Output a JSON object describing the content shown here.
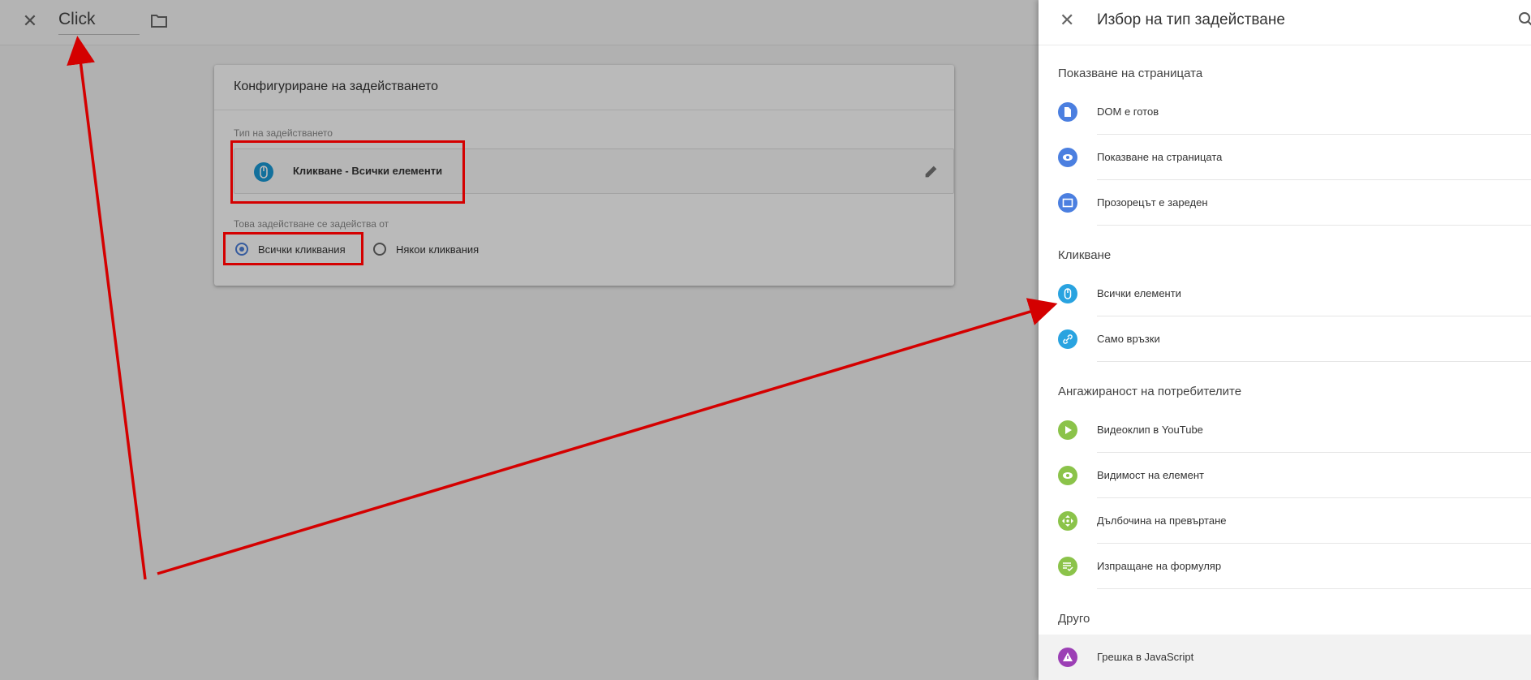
{
  "editor": {
    "close_icon": "close-icon",
    "tag_name": "Click",
    "folder_icon": "folder-icon",
    "card_title": "Конфигуриране на задействането",
    "trigger_type_label": "Тип на задействането",
    "trigger_type_value": "Кликване - Всички елементи",
    "fires_on_label": "Това задействане се задейства от",
    "radio_all": "Всички кликвания",
    "radio_some": "Някои кликвания",
    "selected_radio": "Всички кликвания"
  },
  "panel": {
    "title": "Избор на тип задействане",
    "sections": [
      {
        "title": "Показване на страницата",
        "items": [
          {
            "label": "DOM е готов",
            "icon": "document-icon",
            "color": "#4b7fe0"
          },
          {
            "label": "Показване на страницата",
            "icon": "eye-icon",
            "color": "#4b7fe0"
          },
          {
            "label": "Прозорецът е зареден",
            "icon": "window-icon",
            "color": "#4b7fe0"
          }
        ]
      },
      {
        "title": "Кликване",
        "items": [
          {
            "label": "Всички елементи",
            "icon": "mouse-icon",
            "color": "#29a3e0"
          },
          {
            "label": "Само връзки",
            "icon": "link-icon",
            "color": "#29a3e0"
          }
        ]
      },
      {
        "title": "Ангажираност на потребителите",
        "items": [
          {
            "label": "Видеоклип в YouTube",
            "icon": "play-icon",
            "color": "#8bc34a"
          },
          {
            "label": "Видимост на елемент",
            "icon": "eye-icon",
            "color": "#8bc34a"
          },
          {
            "label": "Дълбочина на превъртане",
            "icon": "scroll-icon",
            "color": "#8bc34a"
          },
          {
            "label": "Изпращане на формуляр",
            "icon": "form-icon",
            "color": "#8bc34a"
          }
        ]
      },
      {
        "title": "Друго",
        "items": [
          {
            "label": "Грешка в JavaScript",
            "icon": "warning-icon",
            "color": "#9c3fb5"
          }
        ]
      }
    ]
  },
  "annotation_color": "#d40000"
}
